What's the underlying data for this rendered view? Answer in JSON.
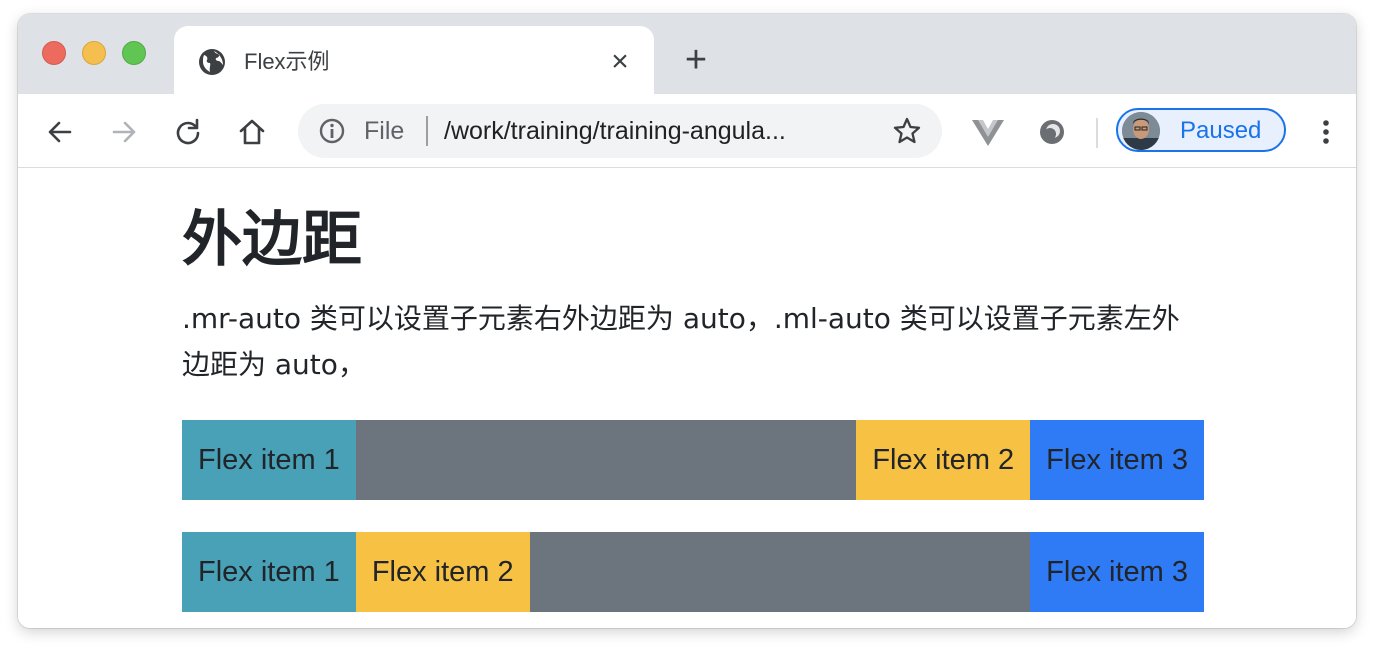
{
  "browser": {
    "tab": {
      "title": "Flex示例",
      "icon": "globe-icon"
    },
    "new_tab_label": "+",
    "close_tab_label": "×",
    "toolbar": {
      "back_icon": "arrow-left-icon",
      "forward_icon": "arrow-right-icon",
      "reload_icon": "reload-icon",
      "home_icon": "home-icon"
    },
    "omnibox": {
      "scheme": "File",
      "url": "/work/training/training-angula..."
    },
    "profile": {
      "label": "Paused"
    }
  },
  "page": {
    "title": "外边距",
    "description": ".mr-auto 类可以设置子元素右外边距为 auto，.ml-auto 类可以设置子元素左外边距为 auto，",
    "rows": [
      {
        "items": [
          {
            "label": "Flex item 1",
            "color": "#48a1b6",
            "margin": "mr-auto"
          },
          {
            "label": "Flex item 2",
            "color": "#f7c244",
            "margin": ""
          },
          {
            "label": "Flex item 3",
            "color": "#2f7bf5",
            "margin": ""
          }
        ]
      },
      {
        "items": [
          {
            "label": "Flex item 1",
            "color": "#48a1b6",
            "margin": ""
          },
          {
            "label": "Flex item 2",
            "color": "#f7c244",
            "margin": ""
          },
          {
            "label": "Flex item 3",
            "color": "#2f7bf5",
            "margin": "ml-auto"
          }
        ]
      }
    ],
    "container_color": "#6c757d"
  }
}
